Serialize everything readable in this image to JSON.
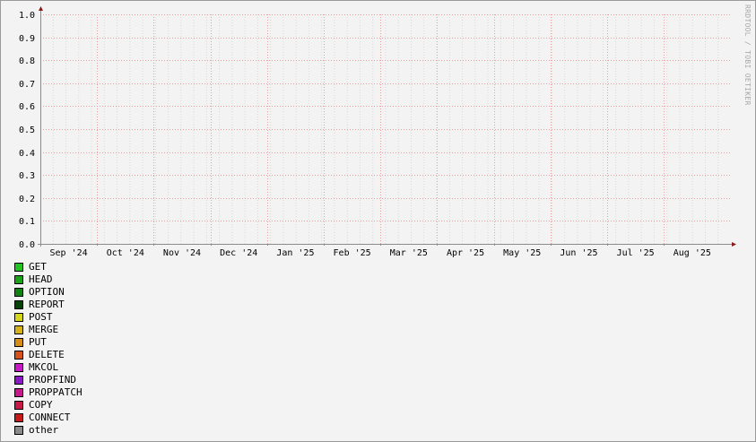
{
  "chart_data": {
    "type": "area",
    "title": "",
    "xlabel": "",
    "ylabel": "",
    "ylim": [
      0,
      1.0
    ],
    "y_ticks": [
      "0.0",
      "0.1",
      "0.2",
      "0.3",
      "0.4",
      "0.5",
      "0.6",
      "0.7",
      "0.8",
      "0.9",
      "1.0"
    ],
    "x_ticks": [
      "Sep '24",
      "Oct '24",
      "Nov '24",
      "Dec '24",
      "Jan '25",
      "Feb '25",
      "Mar '25",
      "Apr '25",
      "May '25",
      "Jun '25",
      "Jul '25",
      "Aug '25"
    ],
    "grid": true,
    "legend_placement": "bottom-left",
    "series": [
      {
        "name": "GET",
        "color": "#22c322",
        "values": []
      },
      {
        "name": "HEAD",
        "color": "#1aa31a",
        "values": []
      },
      {
        "name": "OPTION",
        "color": "#128312",
        "values": []
      },
      {
        "name": "REPORT",
        "color": "#0a430a",
        "values": []
      },
      {
        "name": "POST",
        "color": "#d6d61a",
        "values": []
      },
      {
        "name": "MERGE",
        "color": "#d6b21a",
        "values": []
      },
      {
        "name": "PUT",
        "color": "#d68e1a",
        "values": []
      },
      {
        "name": "DELETE",
        "color": "#d6521a",
        "values": []
      },
      {
        "name": "MKCOL",
        "color": "#c61ac6",
        "values": []
      },
      {
        "name": "PROPFIND",
        "color": "#8a1ac6",
        "values": []
      },
      {
        "name": "PROPPATCH",
        "color": "#c61a8a",
        "values": []
      },
      {
        "name": "COPY",
        "color": "#c61a4a",
        "values": []
      },
      {
        "name": "CONNECT",
        "color": "#c61a1a",
        "values": []
      },
      {
        "name": "other",
        "color": "#8a8a8a",
        "values": []
      }
    ],
    "colors": {
      "major_grid": "#e8a0a0",
      "minor_grid": "#d8d8d8",
      "axis": "#8c8c8c",
      "arrow": "#8a1a1a",
      "tick_text": "#000000"
    }
  },
  "watermark": "RRDTOOL / TOBI OETIKER"
}
